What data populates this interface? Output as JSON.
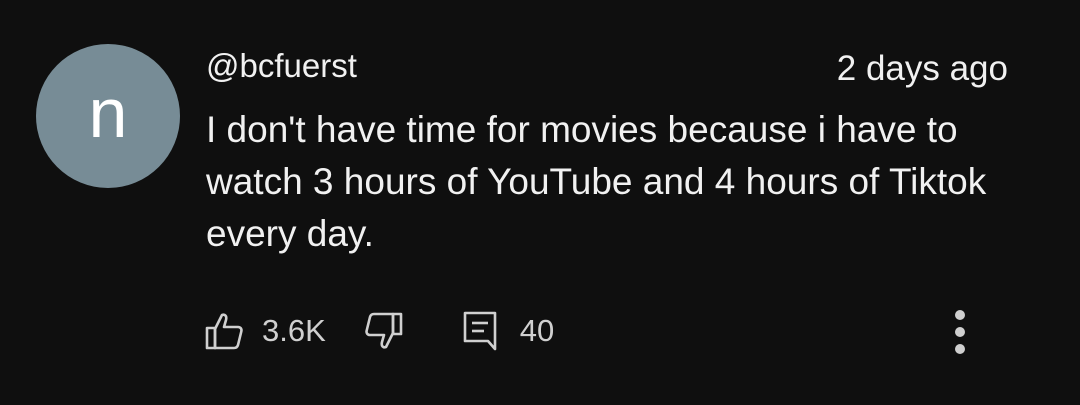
{
  "comment": {
    "avatar_letter": "n",
    "avatar_color": "#778c96",
    "handle": "@bcfuerst",
    "timestamp": "2 days ago",
    "text": "I don't have time for movies because i have to watch 3 hours of YouTube and 4 hours of Tiktok every day.",
    "actions": {
      "like_icon": "thumbs-up-icon",
      "like_count": "3.6K",
      "dislike_icon": "thumbs-down-icon",
      "reply_icon": "reply-comment-icon",
      "reply_count": "40",
      "more_icon": "more-vertical-icon"
    }
  },
  "colors": {
    "background": "#0f0f0f",
    "text": "#f1f1f1",
    "secondary_text": "#d0d0d0"
  }
}
